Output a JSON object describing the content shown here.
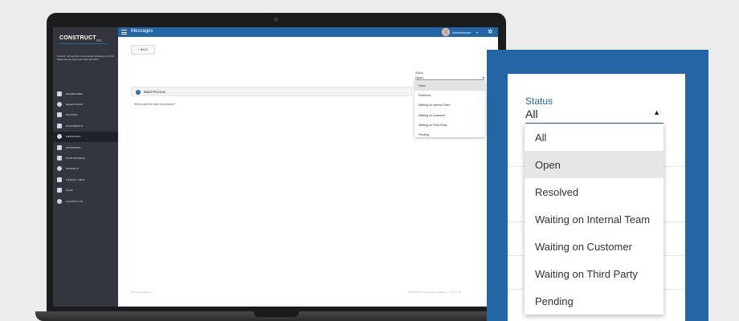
{
  "app": {
    "logo_text": "CONSTRUCT",
    "logo_sub": "IVE",
    "job_info": "CC1111 - Mr and Mrs Constructive Software Lot 3745 Sallie Avenue Harmonie Park WA 6927",
    "header_title": "Messages",
    "user_name": "Administrator",
    "user_caret": "▾",
    "settings_glyph": "✲",
    "back_label": "BACK",
    "section_title": "Build Process",
    "section_icon": "?",
    "question": "When will the slab be poured?",
    "footer_left": "Privacy    Disclaimer",
    "footer_right": "© 2016-2021 Constructive Software  ·  v. 8.12.1 1b"
  },
  "sidebar": {
    "items": [
      {
        "label": "DASHBOARD",
        "icon": "dashboard-icon"
      },
      {
        "label": "SELECTIONS",
        "icon": "selections-icon"
      },
      {
        "label": "PHOTOS",
        "icon": "photos-icon"
      },
      {
        "label": "DOCUMENTS",
        "icon": "documents-icon"
      },
      {
        "label": "MESSAGES",
        "icon": "messages-icon",
        "active": true
      },
      {
        "label": "PROGRESS",
        "icon": "progress-icon"
      },
      {
        "label": "MAINTENANCE",
        "icon": "maintenance-icon"
      },
      {
        "label": "SURVEYS",
        "icon": "surveys-icon"
      },
      {
        "label": "USEFUL LINKS",
        "icon": "link-icon"
      },
      {
        "label": "FAQS",
        "icon": "help-icon"
      },
      {
        "label": "CONTACT US",
        "icon": "phone-icon"
      }
    ]
  },
  "status_small": {
    "label": "Status",
    "value": "Open",
    "options": [
      "Open",
      "Resolved",
      "Waiting on Internal Team",
      "Waiting on Customer",
      "Waiting on Third Party",
      "Pending"
    ],
    "highlighted": "Open"
  },
  "status_zoom": {
    "label": "Status",
    "value": "All",
    "caret": "▲",
    "options": [
      "All",
      "Open",
      "Resolved",
      "Waiting on Internal Team",
      "Waiting on Customer",
      "Waiting on Third Party",
      "Pending"
    ],
    "highlighted": "Open"
  },
  "colors": {
    "brand_blue": "#2465a6",
    "sidebar_bg": "#34363d"
  }
}
